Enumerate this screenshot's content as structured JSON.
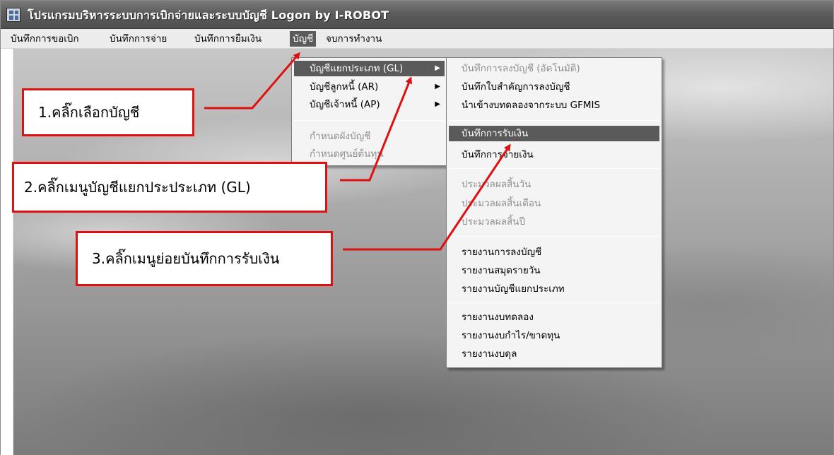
{
  "window": {
    "title": "โปรแกรมบริหารระบบการเบิกจ่ายและระบบบัญชี Logon by I-ROBOT"
  },
  "icons": {
    "app": "app-grid-icon",
    "submenu_arrow": "submenu-arrow-icon"
  },
  "menubar": {
    "items": [
      {
        "label": "บันทึกการขอเบิก"
      },
      {
        "label": "บันทึกการจ่าย"
      },
      {
        "label": "บันทึกการยืมเงิน"
      },
      {
        "label": "บัญชี",
        "active": true
      },
      {
        "label": "จบการทำงาน"
      }
    ]
  },
  "account_menu": {
    "items": [
      {
        "label": "บัญชีแยกประเภท (GL)",
        "submenu": true,
        "highlighted": true
      },
      {
        "label": "บัญชีลูกหนี้ (AR)",
        "submenu": true
      },
      {
        "label": "บัญชีเจ้าหนี้ (AP)",
        "submenu": true
      },
      {
        "label": "กำหนดผังบัญชี",
        "disabled": true
      },
      {
        "label": "กำหนดศูนย์ต้นทุน",
        "disabled": true
      }
    ]
  },
  "gl_menu": {
    "items": [
      {
        "label": "บันทึกการลงบัญชี (อัตโนมัติ)",
        "disabled": true
      },
      {
        "label": "บันทึกใบสำคัญการลงบัญชี"
      },
      {
        "label": "นำเข้างบทดลองจากระบบ GFMIS"
      },
      {
        "label": "บันทึกการรับเงิน",
        "highlighted": true
      },
      {
        "label": "บันทึกการจ่ายเงิน"
      },
      {
        "label": "ประมวลผลสิ้นวัน",
        "disabled": true
      },
      {
        "label": "ประมวลผลสิ้นเดือน",
        "disabled": true
      },
      {
        "label": "ประมวลผลสิ้นปี",
        "disabled": true
      },
      {
        "label": "รายงานการลงบัญชี"
      },
      {
        "label": "รายงานสมุดรายวัน"
      },
      {
        "label": "รายงานบัญชีแยกประเภท"
      },
      {
        "label": "รายงานงบทดลอง"
      },
      {
        "label": "รายงานงบกำไร/ขาดทุน"
      },
      {
        "label": "รายงานงบดุล"
      }
    ]
  },
  "callouts": {
    "step1": "1.คลิ๊กเลือกบัญชี",
    "step2": "2.คลิ๊กเมนูบัญชีแยกประประเภท (GL)",
    "step3": "3.คลิ๊กเมนูย่อยบันทึกการรับเงิน"
  },
  "colors": {
    "callout_border": "#e01010",
    "arrow": "#e01010",
    "menu_highlight": "#5a5a5a",
    "titlebar": "#5d5d5d"
  }
}
